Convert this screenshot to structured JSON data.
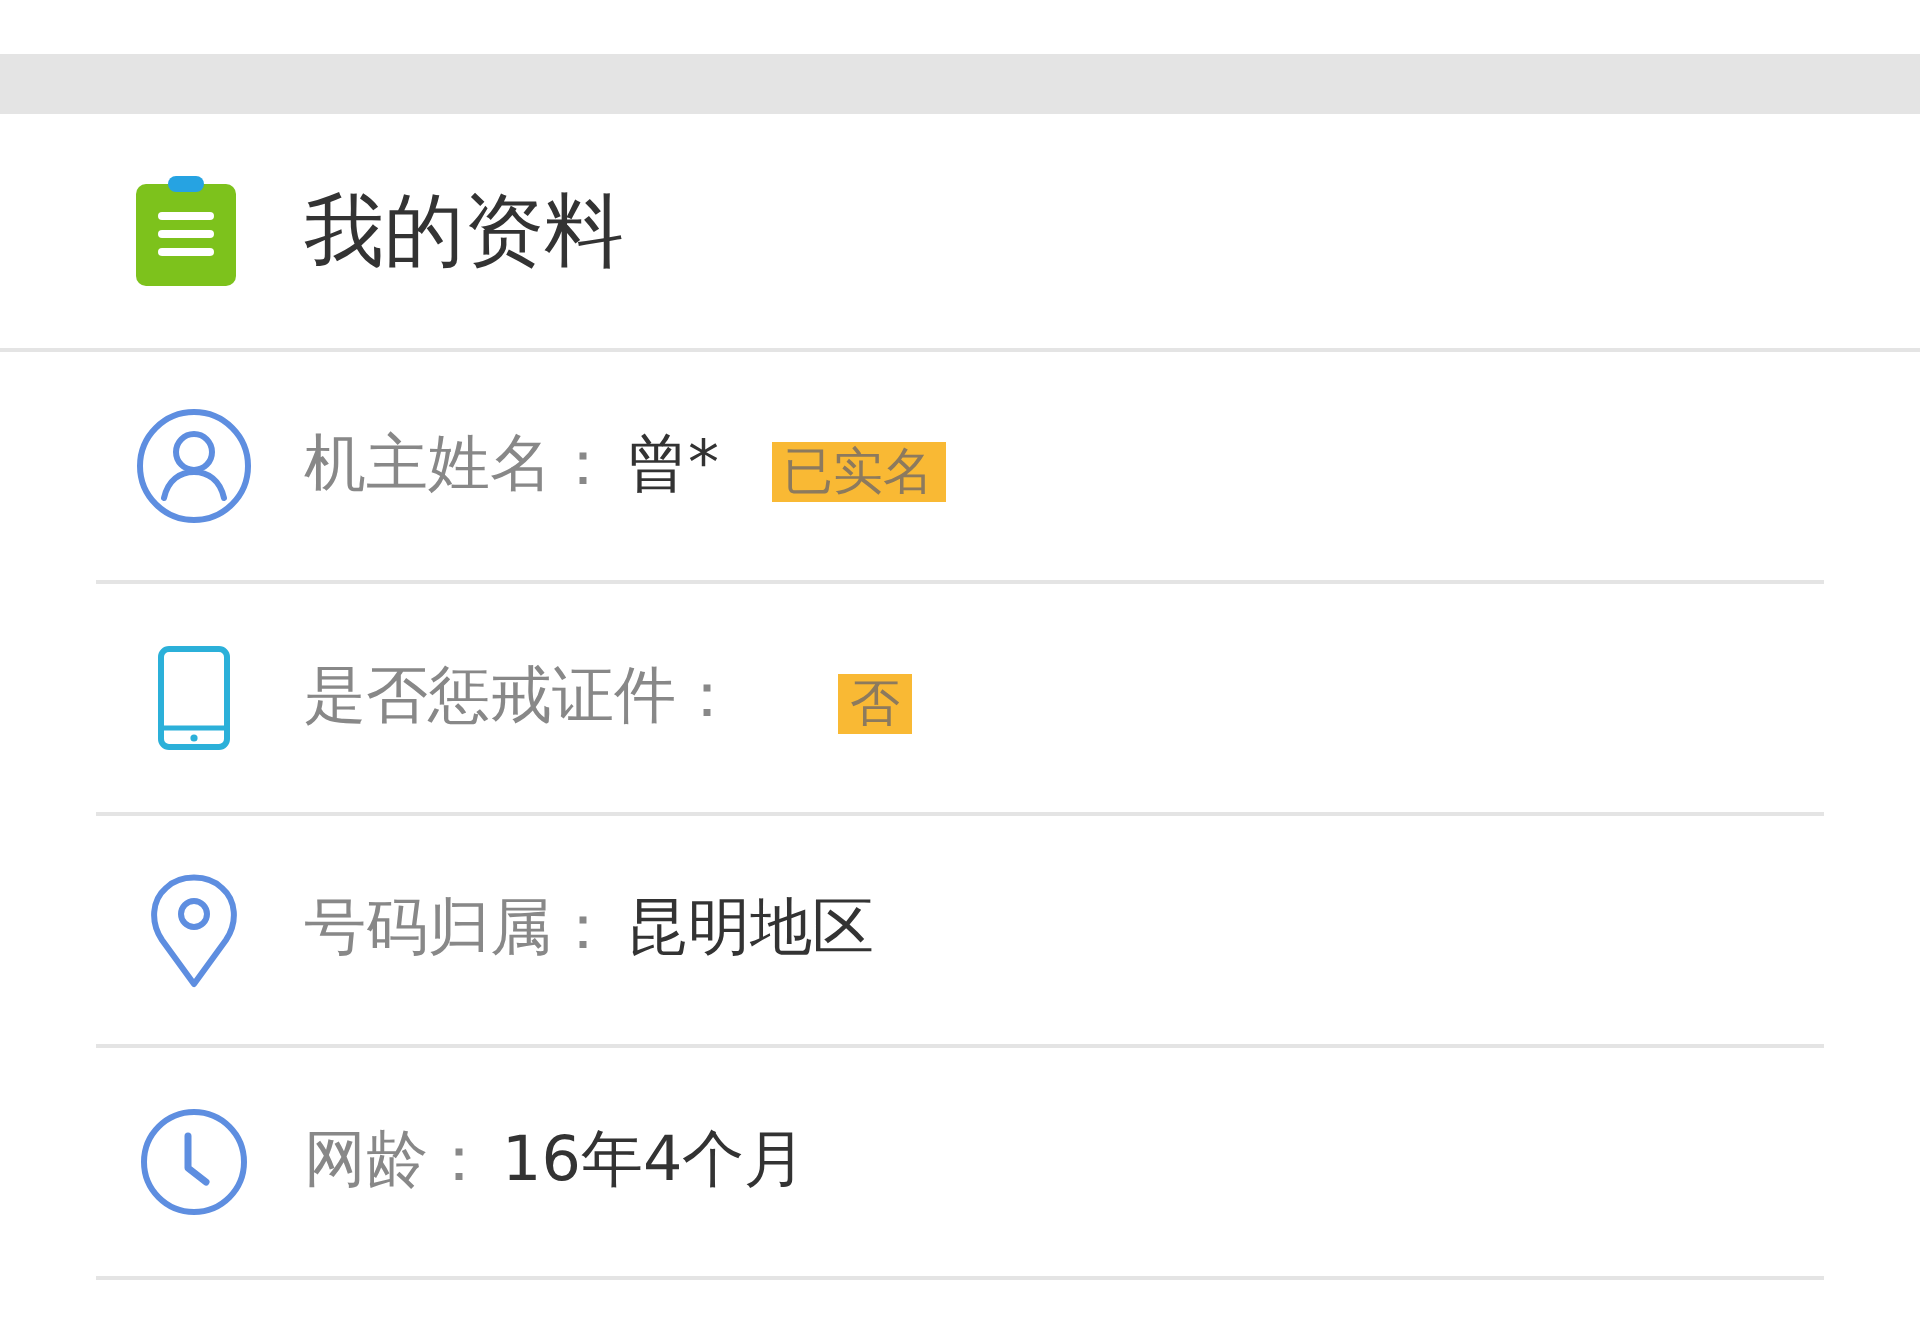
{
  "header": {
    "title": "我的资料"
  },
  "rows": [
    {
      "kind": "person",
      "label": "机主姓名：",
      "value": "曾*",
      "badge": "已实名"
    },
    {
      "kind": "phone",
      "label": "是否惩戒证件：",
      "badge": "否"
    },
    {
      "kind": "location",
      "label": "号码归属：",
      "value": "昆明地区"
    },
    {
      "kind": "clock",
      "label": "网龄：",
      "value": "16年4个月"
    }
  ]
}
